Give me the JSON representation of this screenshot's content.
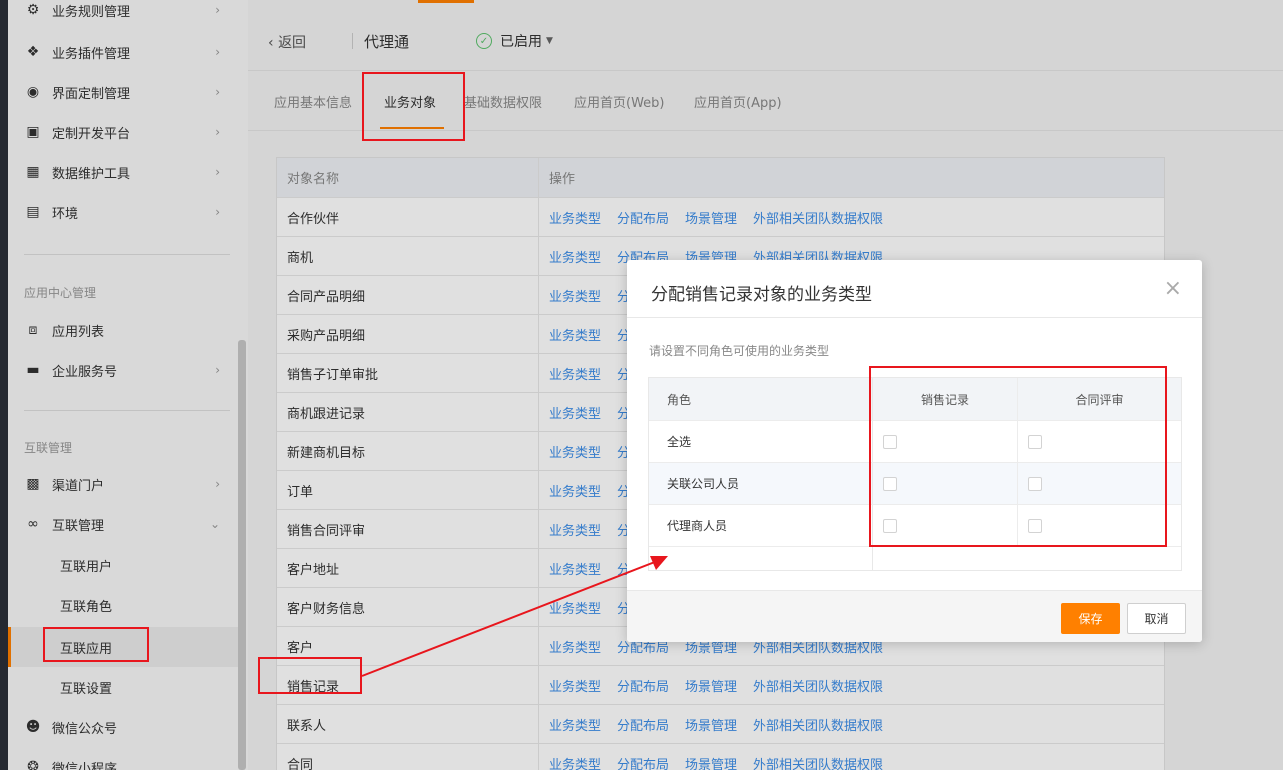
{
  "sidebar": {
    "top_item": "业务规则管理",
    "items": [
      {
        "label": "业务插件管理",
        "icon": "puzzle-icon"
      },
      {
        "label": "界面定制管理",
        "icon": "palette-icon"
      },
      {
        "label": "定制开发平台",
        "icon": "code-icon"
      },
      {
        "label": "数据维护工具",
        "icon": "chart-icon"
      },
      {
        "label": "环境",
        "icon": "monitor-icon"
      }
    ],
    "group_app": "应用中心管理",
    "app_items": [
      {
        "label": "应用列表",
        "icon": "grid-icon"
      },
      {
        "label": "企业服务号",
        "icon": "message-icon"
      }
    ],
    "group_interconnect": "互联管理",
    "ic_items": [
      {
        "label": "渠道门户",
        "icon": "bar-chart-icon"
      },
      {
        "label": "互联管理",
        "icon": "infinity-icon"
      }
    ],
    "sub_items": [
      "互联用户",
      "互联角色",
      "互联应用",
      "互联设置"
    ],
    "bottom_items": [
      {
        "label": "微信公众号",
        "icon": "wechat-icon"
      },
      {
        "label": "微信小程序",
        "icon": "miniapp-icon"
      }
    ]
  },
  "header": {
    "back": "返回",
    "title": "代理通",
    "status": "已启用"
  },
  "tabs": [
    "应用基本信息",
    "业务对象",
    "基础数据权限",
    "应用首页(Web)",
    "应用首页(App)"
  ],
  "table": {
    "headers": [
      "对象名称",
      "操作"
    ],
    "ops": [
      "业务类型",
      "分配布局",
      "场景管理",
      "外部相关团队数据权限"
    ],
    "rows": [
      "合作伙伴",
      "商机",
      "合同产品明细",
      "采购产品明细",
      "销售子订单审批",
      "商机跟进记录",
      "新建商机目标",
      "订单",
      "销售合同评审",
      "客户地址",
      "客户财务信息",
      "客户",
      "销售记录",
      "联系人",
      "合同"
    ]
  },
  "modal": {
    "title": "分配销售记录对象的业务类型",
    "hint": "请设置不同角色可使用的业务类型",
    "headers": [
      "角色",
      "销售记录",
      "合同评审"
    ],
    "rows": [
      "全选",
      "关联公司人员",
      "代理商人员"
    ],
    "save": "保存",
    "cancel": "取消"
  },
  "colors": {
    "accent": "#ff8000",
    "link": "#3d8ee8",
    "annotation": "#e8161d"
  }
}
